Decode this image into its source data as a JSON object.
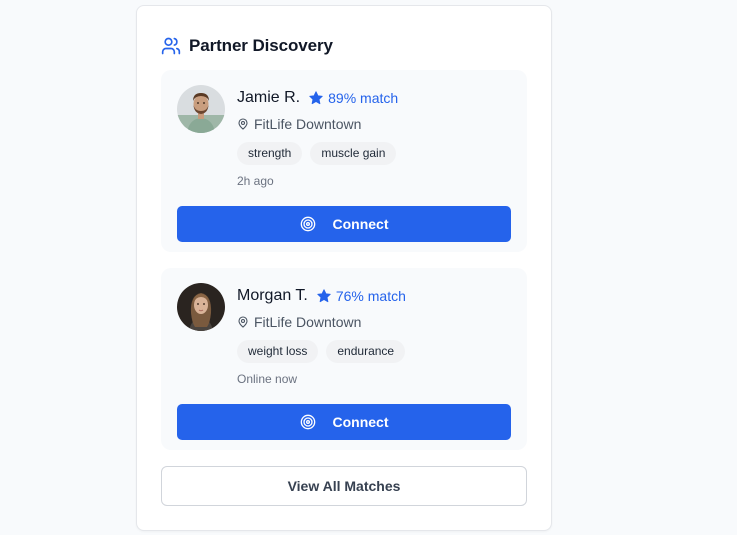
{
  "header": {
    "icon": "users-icon",
    "title": "Partner Discovery"
  },
  "partners": [
    {
      "name": "Jamie R.",
      "match": "89% match",
      "location": "FitLife Downtown",
      "tags": [
        "strength",
        "muscle gain"
      ],
      "status": "2h ago",
      "connect_label": "Connect"
    },
    {
      "name": "Morgan T.",
      "match": "76% match",
      "location": "FitLife Downtown",
      "tags": [
        "weight loss",
        "endurance"
      ],
      "status": "Online now",
      "connect_label": "Connect"
    }
  ],
  "view_all_label": "View All Matches",
  "colors": {
    "accent": "#2563eb",
    "card_bg": "#ffffff",
    "partner_bg": "#f8fafc",
    "tag_bg": "#f1f2f4"
  }
}
